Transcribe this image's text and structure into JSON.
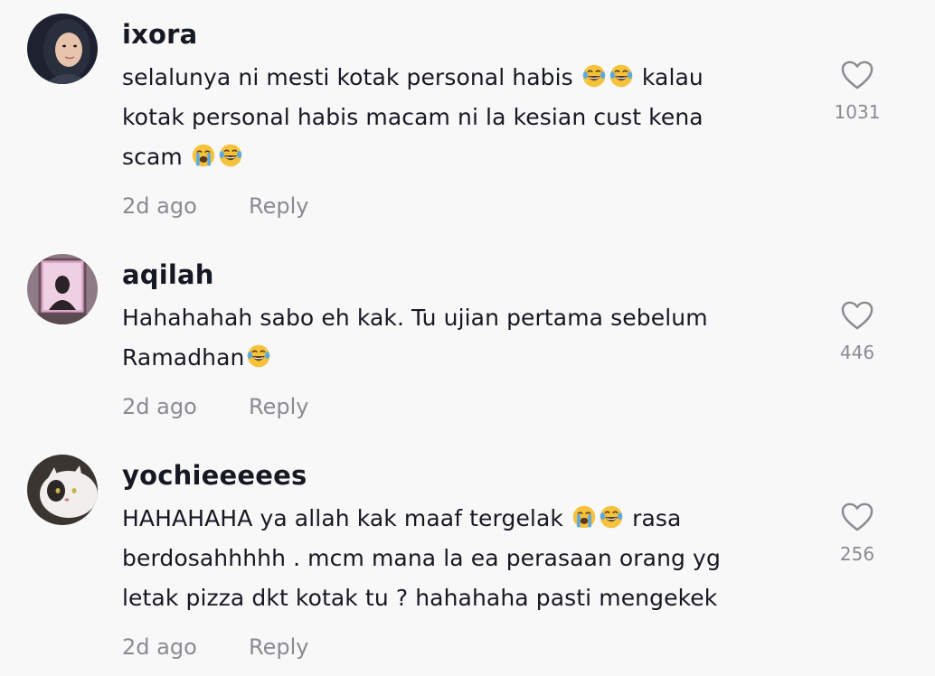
{
  "comments": [
    {
      "username": "ixora",
      "text": "selalunya ni mesti kotak personal habis 😂😂 kalau kotak personal habis macam ni la kesian cust kena scam 😭😂",
      "segments": [
        "selalunya ni mesti kotak personal habis ",
        " kalau",
        "kotak personal habis macam ni la kesian cust kena",
        "scam "
      ],
      "time": "2d ago",
      "reply_label": "Reply",
      "likes": "1031",
      "avatar_icon": "profile-photo-woman-hijab"
    },
    {
      "username": "aqilah",
      "text": "Hahahahah sabo eh kak. Tu ujian pertama sebelum Ramadhan😂",
      "segments": [
        "Hahahahah sabo eh kak. Tu ujian pertama sebelum",
        "Ramadhan"
      ],
      "time": "2d ago",
      "reply_label": "Reply",
      "likes": "446",
      "avatar_icon": "profile-photo-mirror-selfie"
    },
    {
      "username": "yochieeeees",
      "text": "HAHAHAHA ya allah kak maaf tergelak 😭😂 rasa berdosahhhhh . mcm mana la ea perasaan orang yg letak pizza dkt kotak tu ? hahahaha pasti mengekek",
      "segments": [
        "HAHAHAHA ya allah kak maaf tergelak ",
        " rasa",
        "berdosahhhhh . mcm mana la ea perasaan orang yg",
        "letak pizza dkt kotak tu ? hahahaha pasti mengekek"
      ],
      "time": "2d ago",
      "reply_label": "Reply",
      "likes": "256",
      "avatar_icon": "profile-photo-cat"
    }
  ],
  "icons": {
    "like": "heart-outline-icon",
    "laugh": "face-with-tears-of-joy-emoji",
    "cry": "loudly-crying-face-emoji"
  },
  "colors": {
    "background": "#f8f8f8",
    "username": "#161823",
    "text": "#161823",
    "meta": "#8a8b91",
    "heart_stroke": "#8a8b91"
  }
}
